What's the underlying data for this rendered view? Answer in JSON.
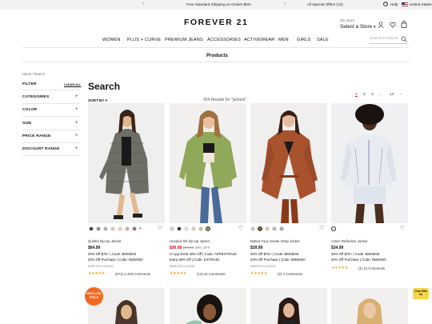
{
  "promo_bar": {
    "shipping": "Free Standard Shipping on Orders $50+",
    "offers": "All Special Offers (13)",
    "help": "Help",
    "country": "United States"
  },
  "header": {
    "brand": "FOREVER 21",
    "store_label": "My store",
    "store_value": "Select a Store",
    "search_placeholder": "Search Products"
  },
  "nav": [
    "WOMEN",
    "PLUS + CURVE",
    "PREMIUM JEANS",
    "ACCESSORIES",
    "ACTIVEWEAR",
    "MEN",
    "GIRLS",
    "SALE"
  ],
  "section_title": "Products",
  "breadcrumb": "Home / Search",
  "filters": {
    "title": "FILTER",
    "clear": "CLEAR ALL",
    "groups": [
      "CATEGORIES",
      "COLOR",
      "SIZE",
      "PRICE RANGE",
      "DISCOUNT RANGE"
    ]
  },
  "search": {
    "heading": "Search",
    "results": "424 Results for \"jackets\"",
    "sort": "SORT BY"
  },
  "pagination": [
    "1",
    "2",
    "3",
    "...",
    "14"
  ],
  "colors": {
    "sale": "#d0021b",
    "star": "#f5a623",
    "badge": "#f26722",
    "chat": "#f7d64a"
  },
  "products": [
    {
      "name": "Quilted Zip-Up Jacket",
      "price": "$64.99",
      "promo1": "30% Off $75+ | Code: BMSM30",
      "promo2": "20% Off Purchase | Code: BMSM20",
      "tag": "WEB EXCLUSIVE",
      "rating": 4.5,
      "stars": "★★★★★",
      "reviews": "(674) 2,449 Comments",
      "swatches": [
        "#3a3a3a",
        "#8a8a7a",
        "#b8a888",
        "#d8c8b0",
        "#e8d0c8",
        "#d8a8a0",
        "#9a6a5a"
      ]
    },
    {
      "name": "Hooded Slit Zip-Up Jacket",
      "price_sale": "$30.00",
      "price_orig": "$49.99",
      "discount": "40% OFF",
      "promo1": "In App Extra 40% Off | Code: APPEXTRA40",
      "promo2": "Extra 30% Off | Code: EXTRA30",
      "tag": "WEB EXCLUSIVE",
      "rating": 4.5,
      "stars": "★★★★★",
      "reviews": "(13) 44 Comments",
      "swatches": [
        "#c8d0d8",
        "#2a2a2a",
        "#e8e0d8",
        "#e8c8c0",
        "#c8b8a0",
        "#8fa85a"
      ]
    },
    {
      "name": "Belted Faux Suede Wrap Jacket",
      "price": "$39.99",
      "promo1": "30% Off $75+ | Code: BMSM30",
      "promo2": "20% Off Purchase | Code: BMSM20",
      "tag": "WEB EXCLUSIVE",
      "rating": 5,
      "stars": "★★★★★",
      "reviews": "(2) 4 Comments",
      "swatches": [
        "#c8c0b8",
        "#a8522e",
        "#d8c8b8",
        "#d0a8a8",
        "#a8a0a0"
      ]
    },
    {
      "name": "Active Reflective Jacket",
      "price": "$34.99",
      "promo1": "30% Off $75+ | Code: BMSM30",
      "promo2": "20% Off Purchase | Code: BMSM20",
      "rating": 5,
      "stars": "★★★★★",
      "reviews": "(1) 21 Comments",
      "swatches": [
        "#e8ecf2"
      ]
    }
  ],
  "badge": "NEW LOW PRICE",
  "chat": "Chat With Us"
}
